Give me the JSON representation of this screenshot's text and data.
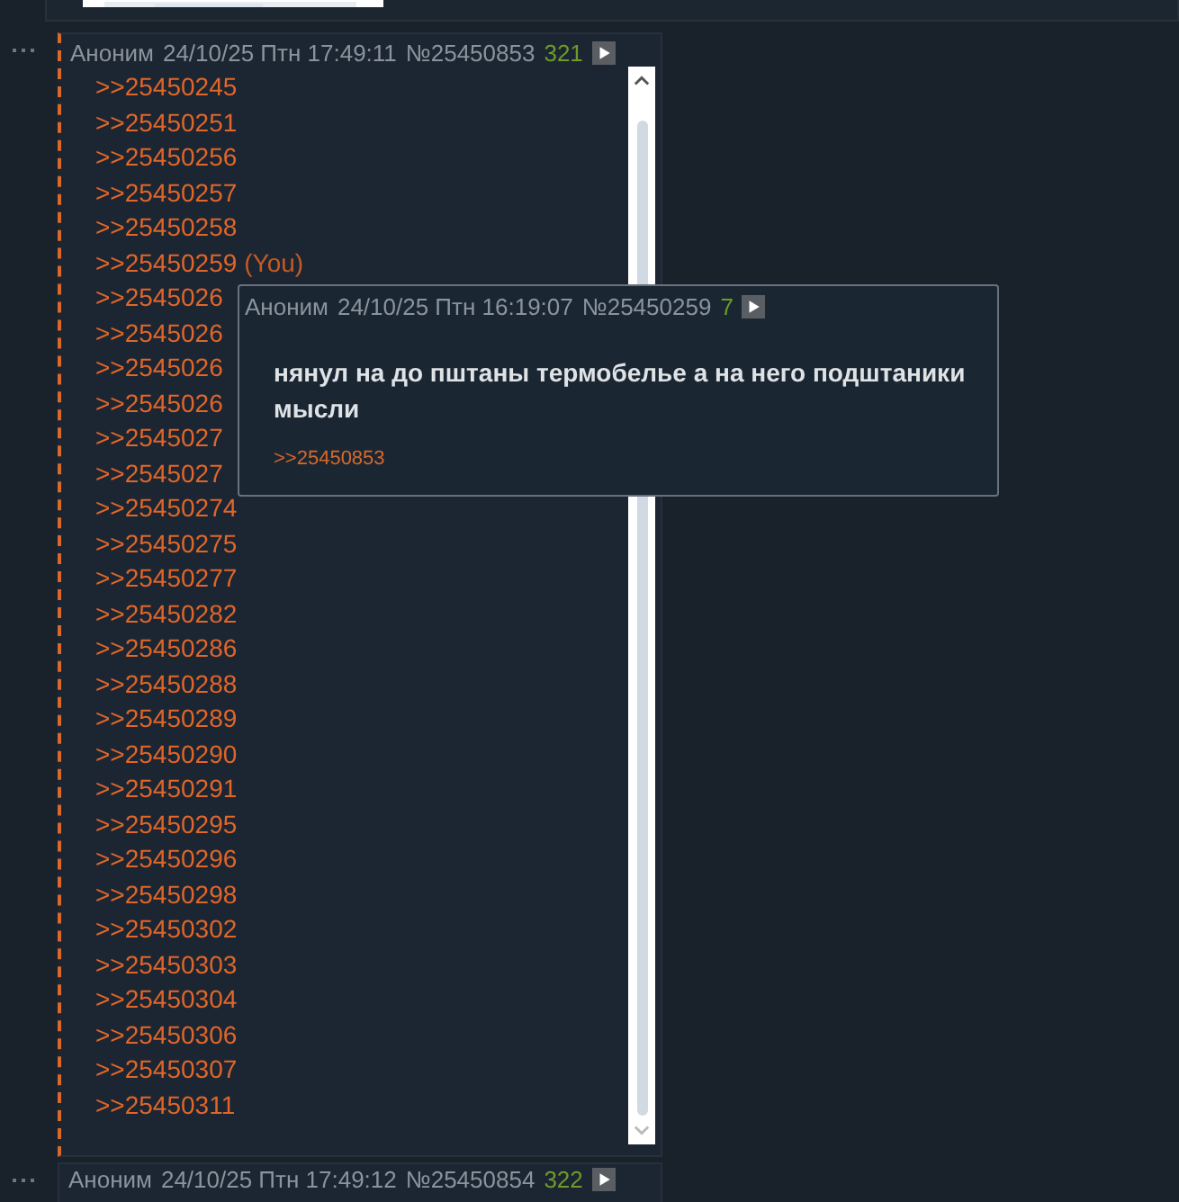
{
  "post": {
    "author": "Аноним",
    "date": "24/10/25 Птн 17:49:11",
    "number": "№25450853",
    "reply_count": "321",
    "replies": [
      {
        "text": ">>25450245"
      },
      {
        "text": ">>25450251"
      },
      {
        "text": ">>25450256"
      },
      {
        "text": ">>25450257"
      },
      {
        "text": ">>25450258"
      },
      {
        "text": ">>25450259",
        "you": "(You)"
      },
      {
        "text": ">>2545026"
      },
      {
        "text": ">>2545026"
      },
      {
        "text": ">>2545026"
      },
      {
        "text": ">>2545026"
      },
      {
        "text": ">>2545027"
      },
      {
        "text": ">>2545027"
      },
      {
        "text": ">>25450274"
      },
      {
        "text": ">>25450275"
      },
      {
        "text": ">>25450277"
      },
      {
        "text": ">>25450282"
      },
      {
        "text": ">>25450286"
      },
      {
        "text": ">>25450288"
      },
      {
        "text": ">>25450289"
      },
      {
        "text": ">>25450290"
      },
      {
        "text": ">>25450291"
      },
      {
        "text": ">>25450295"
      },
      {
        "text": ">>25450296"
      },
      {
        "text": ">>25450298"
      },
      {
        "text": ">>25450302"
      },
      {
        "text": ">>25450303"
      },
      {
        "text": ">>25450304"
      },
      {
        "text": ">>25450306"
      },
      {
        "text": ">>25450307"
      },
      {
        "text": ">>25450311"
      }
    ]
  },
  "popup": {
    "author": "Аноним",
    "date": "24/10/25 Птн 16:19:07",
    "number": "№25450259",
    "reply_count": "7",
    "body": "нянул на до пштаны термобелье а на него подштаники мысли",
    "backlink": ">>25450853"
  },
  "next_post": {
    "author": "Аноним",
    "date": "24/10/25 Птн 17:49:12",
    "number": "№25450854",
    "reply_count": "322"
  }
}
